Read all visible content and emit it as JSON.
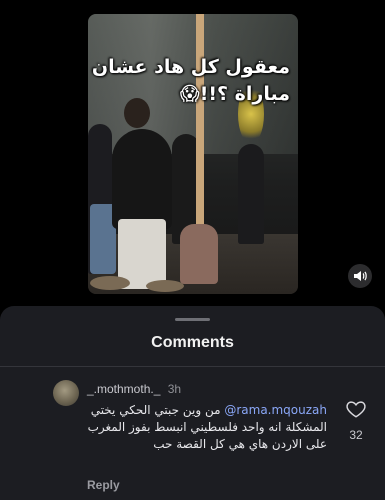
{
  "video": {
    "caption": "معقول كل هاد عشان مباراة ؟!!😱",
    "sound_icon": "speaker-icon"
  },
  "comments_sheet": {
    "title": "Comments",
    "comment": {
      "username": "_.mothmoth._",
      "time": "3h",
      "mention": "@rama.mqouzah",
      "text": "من وين جبتي الحكي يختي المشكلة انه واحد فلسطيني انبسط بفوز المغرب على الاردن هاي هي كل القصة حب",
      "reply_label": "Reply",
      "like_count": "32",
      "like_icon": "heart-icon"
    }
  },
  "colors": {
    "background": "#000000",
    "sheet": "#1c1d22",
    "mention": "#8aa7f7"
  }
}
